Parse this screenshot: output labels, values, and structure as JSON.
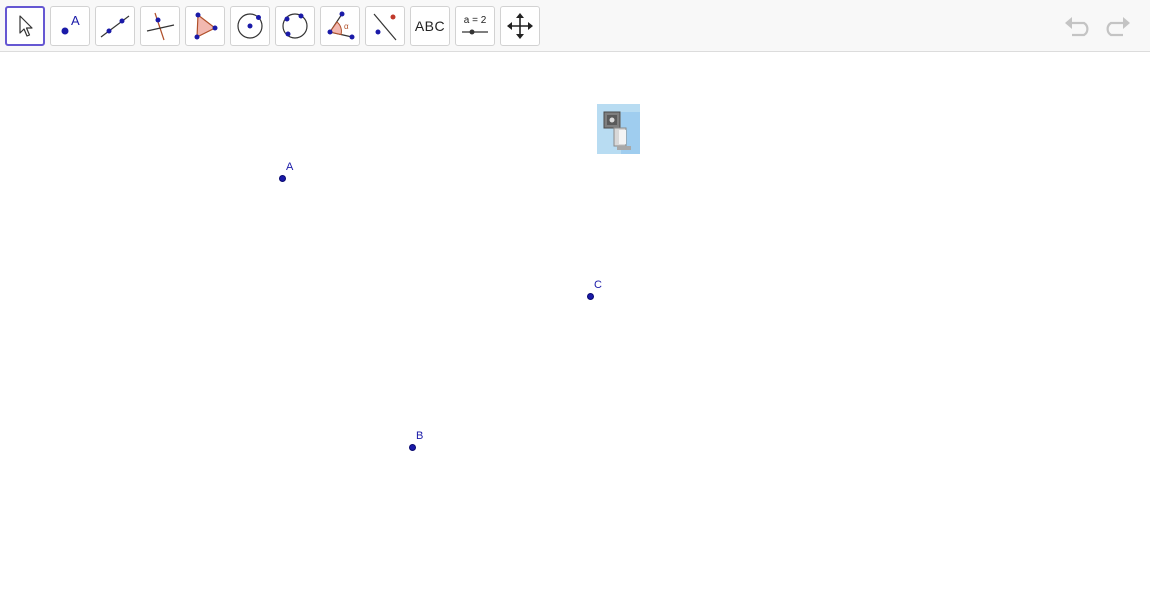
{
  "toolbar": {
    "tools": [
      {
        "name": "Move",
        "icon": "move-cursor-icon",
        "selected": true
      },
      {
        "name": "Point",
        "icon": "point-icon",
        "label": "A"
      },
      {
        "name": "Line",
        "icon": "line-icon"
      },
      {
        "name": "Perpendicular Line",
        "icon": "perpendicular-line-icon"
      },
      {
        "name": "Polygon",
        "icon": "polygon-icon"
      },
      {
        "name": "Circle with Center through Point",
        "icon": "circle-center-point-icon"
      },
      {
        "name": "Circle through 3 Points",
        "icon": "circle-three-points-icon"
      },
      {
        "name": "Angle",
        "icon": "angle-icon"
      },
      {
        "name": "Reflect about Line",
        "icon": "reflect-line-icon"
      },
      {
        "name": "Text",
        "icon": "text-tool-icon",
        "label": "ABC"
      },
      {
        "name": "Slider",
        "icon": "slider-icon",
        "label": "a = 2"
      },
      {
        "name": "Move Graphics View",
        "icon": "move-graphics-view-icon"
      }
    ],
    "undo": {
      "icon": "undo-icon",
      "enabled": false
    },
    "redo": {
      "icon": "redo-icon",
      "enabled": false
    }
  },
  "canvas": {
    "points": [
      {
        "label": "A"
      },
      {
        "label": "B"
      },
      {
        "label": "C"
      }
    ],
    "image_object": {
      "icon": "inserted-image-icon"
    }
  },
  "colors": {
    "point": "#1a1aa8",
    "selected_border": "#6557d2",
    "toolbar_bg": "#f8f8f8"
  }
}
